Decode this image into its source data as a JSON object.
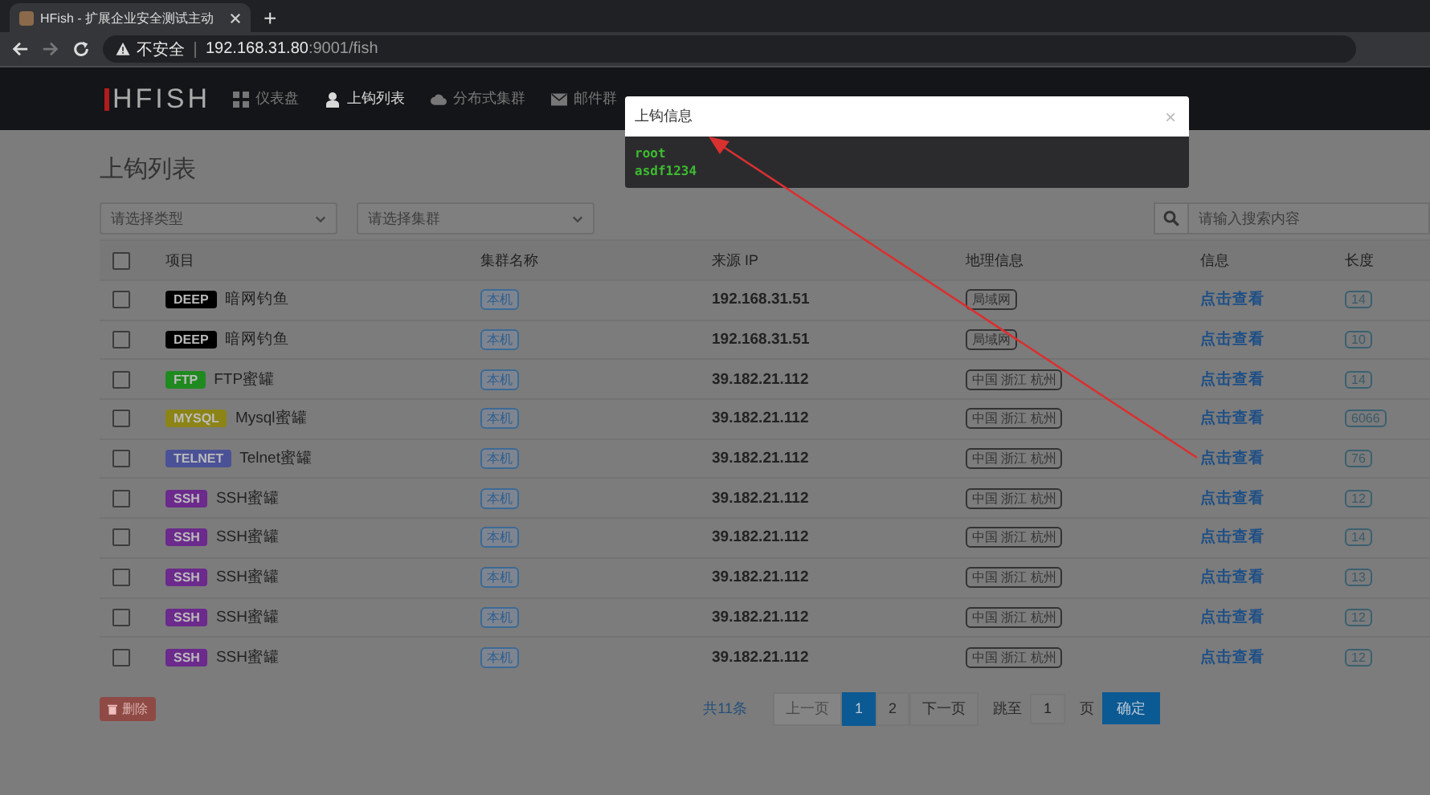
{
  "browser": {
    "tab_title": "HFish - 扩展企业安全测试主动",
    "new_tab": "+",
    "security": "不安全",
    "url_host": "192.168.31.80",
    "url_rest": ":9001/fish"
  },
  "nav": {
    "logo": "HFISH",
    "items": [
      {
        "label": "仪表盘",
        "selected": false
      },
      {
        "label": "上钩列表",
        "selected": true
      },
      {
        "label": "分布式集群",
        "selected": false
      },
      {
        "label": "邮件群",
        "selected": false
      }
    ]
  },
  "page_title": "上钩列表",
  "filters": [
    {
      "placeholder": "请选择类型"
    },
    {
      "placeholder": "请选择集群"
    }
  ],
  "search": {
    "placeholder": "请输入搜索内容"
  },
  "table": {
    "all_checked": false,
    "columns": [
      "项目",
      "集群名称",
      "来源 IP",
      "地理信息",
      "信息",
      "长度"
    ],
    "rows": [
      {
        "checked": false,
        "type": "DEEP",
        "color": "#000000",
        "name": "暗网钓鱼",
        "cluster": "本机",
        "ip": "192.168.31.51",
        "geo": "局域网",
        "info": "点击查看",
        "length": "14"
      },
      {
        "checked": false,
        "type": "DEEP",
        "color": "#000000",
        "name": "暗网钓鱼",
        "cluster": "本机",
        "ip": "192.168.31.51",
        "geo": "局域网",
        "info": "点击查看",
        "length": "10"
      },
      {
        "checked": false,
        "type": "FTP",
        "color": "#1f8a1f",
        "name": "FTP蜜罐",
        "cluster": "本机",
        "ip": "39.182.21.112",
        "geo": "中国 浙江 杭州",
        "info": "点击查看",
        "length": "14"
      },
      {
        "checked": false,
        "type": "MYSQL",
        "color": "#8c8416",
        "name": "Mysql蜜罐",
        "cluster": "本机",
        "ip": "39.182.21.112",
        "geo": "中国 浙江 杭州",
        "info": "点击查看",
        "length": "6066"
      },
      {
        "checked": false,
        "type": "TELNET",
        "color": "#4b5196",
        "name": "Telnet蜜罐",
        "cluster": "本机",
        "ip": "39.182.21.112",
        "geo": "中国 浙江 杭州",
        "info": "点击查看",
        "length": "76"
      },
      {
        "checked": false,
        "type": "SSH",
        "color": "#6b2a8c",
        "name": "SSH蜜罐",
        "cluster": "本机",
        "ip": "39.182.21.112",
        "geo": "中国 浙江 杭州",
        "info": "点击查看",
        "length": "12"
      },
      {
        "checked": false,
        "type": "SSH",
        "color": "#6b2a8c",
        "name": "SSH蜜罐",
        "cluster": "本机",
        "ip": "39.182.21.112",
        "geo": "中国 浙江 杭州",
        "info": "点击查看",
        "length": "14"
      },
      {
        "checked": false,
        "type": "SSH",
        "color": "#6b2a8c",
        "name": "SSH蜜罐",
        "cluster": "本机",
        "ip": "39.182.21.112",
        "geo": "中国 浙江 杭州",
        "info": "点击查看",
        "length": "13"
      },
      {
        "checked": false,
        "type": "SSH",
        "color": "#6b2a8c",
        "name": "SSH蜜罐",
        "cluster": "本机",
        "ip": "39.182.21.112",
        "geo": "中国 浙江 杭州",
        "info": "点击查看",
        "length": "12"
      },
      {
        "checked": false,
        "type": "SSH",
        "color": "#6b2a8c",
        "name": "SSH蜜罐",
        "cluster": "本机",
        "ip": "39.182.21.112",
        "geo": "中国 浙江 杭州",
        "info": "点击查看",
        "length": "12"
      }
    ]
  },
  "delete_button": "删除",
  "pagination": {
    "total": "共11条",
    "prev": {
      "label": "上一页",
      "disabled": true
    },
    "pages": [
      {
        "label": "1",
        "selected": true
      },
      {
        "label": "2",
        "selected": false
      }
    ],
    "next": {
      "label": "下一页",
      "disabled": false
    },
    "jump_label": "跳至",
    "jump_value": "1",
    "page_unit": "页",
    "confirm": "确定"
  },
  "modal": {
    "title": "上钩信息",
    "close": "×",
    "lines": [
      "root",
      "asdf1234"
    ]
  }
}
